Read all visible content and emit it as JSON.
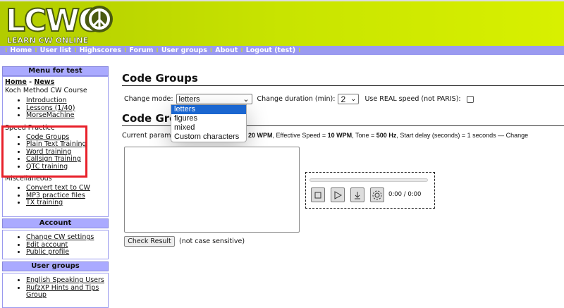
{
  "header": {
    "logo": "LCWO",
    "tagline": "LEARN CW ONLINE"
  },
  "nav": [
    "Home",
    "User list",
    "Highscores",
    "Forum",
    "User groups",
    "About",
    "Logout (test)"
  ],
  "sidebar": {
    "menu_title": "Menu for test",
    "home": "Home",
    "sep": "-",
    "news": "News",
    "koch_title": "Koch Method CW Course",
    "koch": [
      "Introduction",
      "Lessons (1/40)",
      "MorseMachine"
    ],
    "speed_title": "Speed Practice",
    "speed": [
      "Code Groups",
      "Plain Text Training",
      "Word training",
      "Callsign Training",
      "QTC training"
    ],
    "misc_title": "Miscellaneous",
    "misc": [
      "Convert text to CW",
      "MP3 practice files",
      "TX training"
    ],
    "account_title": "Account",
    "account": [
      "Change CW settings",
      "Edit account",
      "Public profile"
    ],
    "groups_title": "User groups",
    "groups": [
      "English Speaking Users",
      "RufzXP Hints and Tips Group"
    ]
  },
  "main": {
    "title": "Code Groups",
    "subtitle": "Code Grou",
    "mode_label": "Change mode:",
    "mode_value": "letters",
    "mode_options": [
      "letters",
      "figures",
      "mixed",
      "Custom characters"
    ],
    "duration_label": "Change duration (min):",
    "duration_value": "2",
    "real_label": "Use REAL speed (not PARIS):",
    "params_prefix": "Current parame",
    "params_speed": "20 WPM",
    "params_eff_label": ", Effective Speed = ",
    "params_eff": "10 WPM",
    "params_tone_label": ", Tone = ",
    "params_tone": "500 Hz",
    "params_rest": ", Start delay (seconds) = 1 seconds — ",
    "params_change": "Change",
    "time": "0:00 / 0:00",
    "check_button": "Check Result",
    "note": "(not case sensitive)"
  },
  "colors": {
    "header": "#c8e400",
    "nav": "#9a9af0",
    "box_header": "#aaaaff",
    "highlight": "#e8202a",
    "selected": "#1a66d0"
  }
}
